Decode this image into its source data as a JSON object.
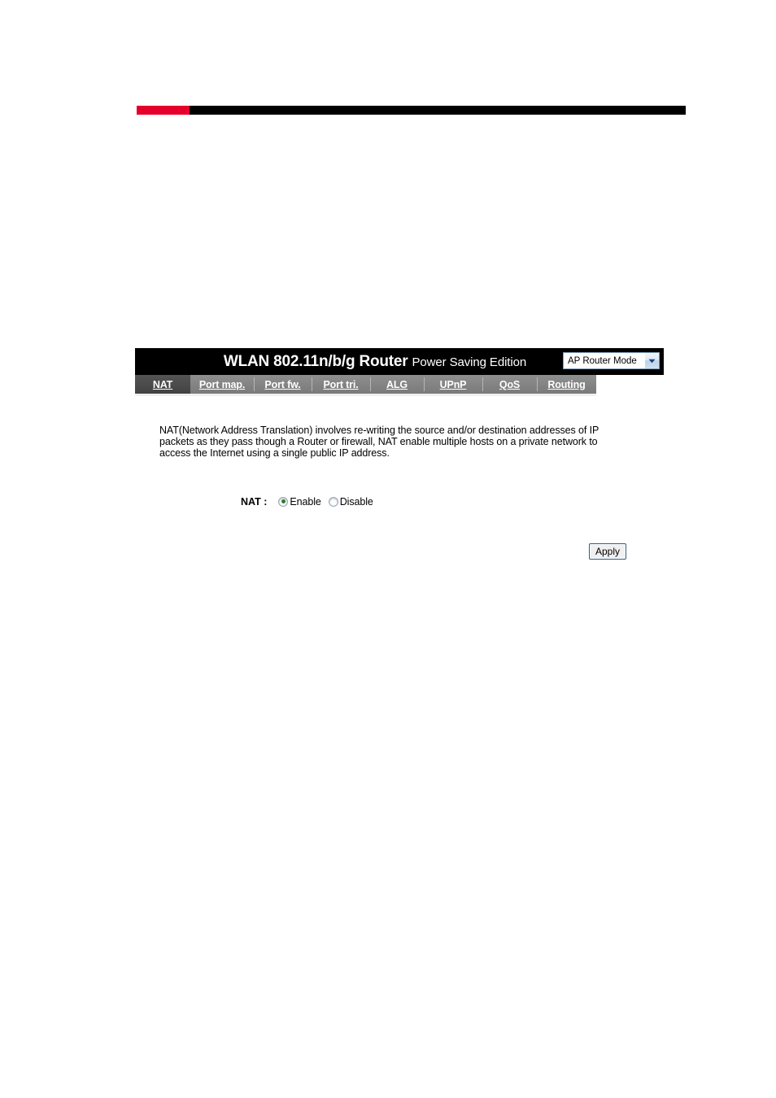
{
  "header_rule": {
    "accent_color": "#e4002b",
    "bar_color": "#000000"
  },
  "panel": {
    "brand_main": "WLAN 802.11n/b/g Router",
    "brand_sub": "Power Saving Edition",
    "mode_select": {
      "selected": "AP Router Mode",
      "arrow_icon": "chevron-down-icon"
    }
  },
  "tabs": [
    {
      "label": "NAT",
      "active": true
    },
    {
      "label": "Port map.",
      "active": false
    },
    {
      "label": "Port fw.",
      "active": false
    },
    {
      "label": "Port tri.",
      "active": false
    },
    {
      "label": "ALG",
      "active": false
    },
    {
      "label": "UPnP",
      "active": false
    },
    {
      "label": "QoS",
      "active": false
    },
    {
      "label": "Routing",
      "active": false
    }
  ],
  "content": {
    "description": "NAT(Network Address Translation) involves re-writing the source and/or destination addresses of IP packets as they pass though a Router or firewall, NAT enable multiple hosts on a private network to access the Internet using a single public IP address.",
    "nat_field": {
      "label": "NAT :",
      "options": [
        {
          "label": "Enable",
          "checked": true
        },
        {
          "label": "Disable",
          "checked": false
        }
      ]
    },
    "apply_label": "Apply"
  }
}
